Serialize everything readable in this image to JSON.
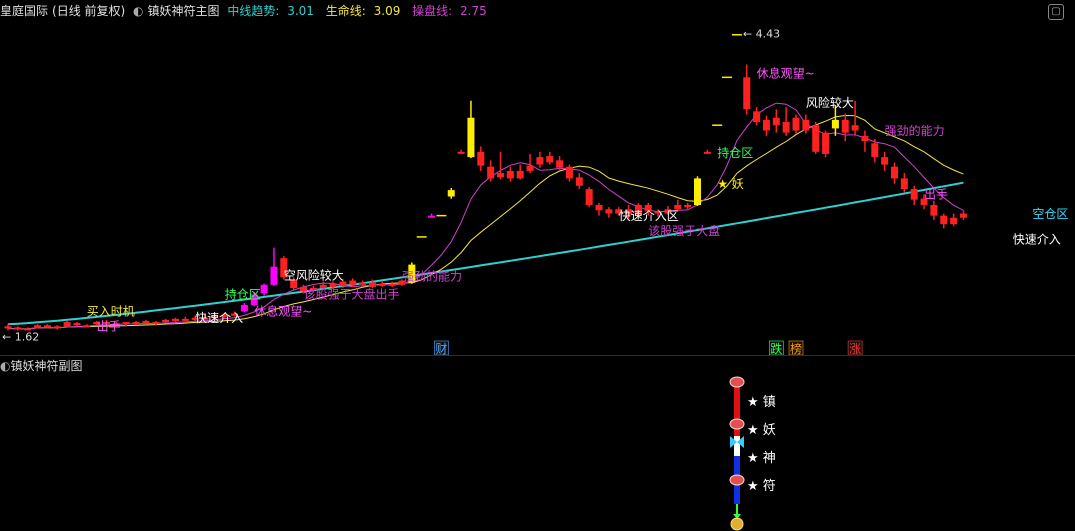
{
  "header": {
    "stock": "皇庭国际",
    "period": "(日线 前复权)",
    "toggle_icon": "collapse-icon",
    "indicator_name": "镇妖神符主图",
    "metrics": [
      {
        "label": "中线趋势: ",
        "value": "3.01",
        "color": "#2fd0d0"
      },
      {
        "label": "生命线: ",
        "value": "3.09",
        "color": "#f5e642"
      },
      {
        "label": "操盘线: ",
        "value": "2.75",
        "color": "#d040d0"
      }
    ]
  },
  "sub_header": {
    "indicator_name": "镇妖神符副图"
  },
  "chart_data": {
    "type": "candlestick",
    "candles": [
      {
        "o": 1.66,
        "c": 1.64,
        "h": 1.68,
        "l": 1.62
      },
      {
        "o": 1.65,
        "c": 1.63,
        "h": 1.66,
        "l": 1.62
      },
      {
        "o": 1.64,
        "c": 1.64,
        "h": 1.65,
        "l": 1.63
      },
      {
        "o": 1.65,
        "c": 1.67,
        "h": 1.68,
        "l": 1.64
      },
      {
        "o": 1.67,
        "c": 1.65,
        "h": 1.68,
        "l": 1.64
      },
      {
        "o": 1.66,
        "c": 1.64,
        "h": 1.67,
        "l": 1.63
      },
      {
        "o": 1.66,
        "c": 1.7,
        "h": 1.71,
        "l": 1.65
      },
      {
        "o": 1.69,
        "c": 1.67,
        "h": 1.7,
        "l": 1.66
      },
      {
        "o": 1.67,
        "c": 1.66,
        "h": 1.68,
        "l": 1.65
      },
      {
        "o": 1.68,
        "c": 1.7,
        "h": 1.71,
        "l": 1.67
      },
      {
        "o": 1.7,
        "c": 1.68,
        "h": 1.72,
        "l": 1.67
      },
      {
        "o": 1.68,
        "c": 1.69,
        "h": 1.7,
        "l": 1.67
      },
      {
        "o": 1.7,
        "c": 1.68,
        "h": 1.7,
        "l": 1.66
      },
      {
        "o": 1.68,
        "c": 1.7,
        "h": 1.71,
        "l": 1.67
      },
      {
        "o": 1.71,
        "c": 1.69,
        "h": 1.72,
        "l": 1.68
      },
      {
        "o": 1.7,
        "c": 1.68,
        "h": 1.71,
        "l": 1.67
      },
      {
        "o": 1.7,
        "c": 1.72,
        "h": 1.73,
        "l": 1.69
      },
      {
        "o": 1.73,
        "c": 1.71,
        "h": 1.74,
        "l": 1.7
      },
      {
        "o": 1.72,
        "c": 1.73,
        "h": 1.75,
        "l": 1.71
      },
      {
        "o": 1.74,
        "c": 1.72,
        "h": 1.76,
        "l": 1.71
      },
      {
        "o": 1.73,
        "c": 1.74,
        "h": 1.77,
        "l": 1.72
      },
      {
        "o": 1.74,
        "c": 1.76,
        "h": 1.78,
        "l": 1.73
      },
      {
        "o": 1.77,
        "c": 1.75,
        "h": 1.78,
        "l": 1.74
      },
      {
        "o": 1.76,
        "c": 1.78,
        "h": 1.8,
        "l": 1.75
      },
      {
        "o": 1.8,
        "c": 1.86,
        "h": 1.88,
        "l": 1.79
      },
      {
        "o": 1.86,
        "c": 1.96,
        "h": 1.98,
        "l": 1.85
      },
      {
        "o": 1.97,
        "c": 2.05,
        "h": 2.06,
        "l": 1.95
      },
      {
        "o": 2.05,
        "c": 2.22,
        "h": 2.4,
        "l": 2.04
      },
      {
        "o": 2.3,
        "c": 2.12,
        "h": 2.32,
        "l": 2.1
      },
      {
        "o": 2.1,
        "c": 2.02,
        "h": 2.12,
        "l": 2.0
      },
      {
        "o": 2.03,
        "c": 1.99,
        "h": 2.05,
        "l": 1.97
      },
      {
        "o": 2.0,
        "c": 2.02,
        "h": 2.04,
        "l": 1.98
      },
      {
        "o": 2.02,
        "c": 2.05,
        "h": 2.08,
        "l": 2.0
      },
      {
        "o": 2.06,
        "c": 2.03,
        "h": 2.08,
        "l": 2.01
      },
      {
        "o": 2.04,
        "c": 2.08,
        "h": 2.1,
        "l": 2.02
      },
      {
        "o": 2.09,
        "c": 2.05,
        "h": 2.11,
        "l": 2.03
      },
      {
        "o": 2.05,
        "c": 2.07,
        "h": 2.09,
        "l": 2.04
      },
      {
        "o": 2.07,
        "c": 2.03,
        "h": 2.1,
        "l": 2.02
      },
      {
        "o": 2.04,
        "c": 2.06,
        "h": 2.08,
        "l": 2.03
      },
      {
        "o": 2.06,
        "c": 2.04,
        "h": 2.08,
        "l": 2.03
      },
      {
        "o": 2.05,
        "c": 2.09,
        "h": 2.1,
        "l": 2.04
      },
      {
        "o": 2.07,
        "c": 2.24,
        "h": 2.26,
        "l": 2.06
      },
      {
        "o": 2.5,
        "c": 2.5,
        "h": 2.52,
        "l": 2.48
      },
      {
        "o": 2.7,
        "c": 2.7,
        "h": 2.72,
        "l": 2.68
      },
      {
        "o": 2.98,
        "c": 2.7,
        "h": 3.0,
        "l": 2.68
      },
      {
        "o": 2.88,
        "c": 2.94,
        "h": 2.96,
        "l": 2.86
      },
      {
        "o": 3.3,
        "c": 3.3,
        "h": 3.32,
        "l": 3.28
      },
      {
        "o": 3.25,
        "c": 3.62,
        "h": 3.78,
        "l": 3.24
      },
      {
        "o": 3.3,
        "c": 3.17,
        "h": 3.35,
        "l": 3.12
      },
      {
        "o": 3.16,
        "c": 3.05,
        "h": 3.22,
        "l": 3.02
      },
      {
        "o": 3.06,
        "c": 3.1,
        "h": 3.3,
        "l": 3.04
      },
      {
        "o": 3.12,
        "c": 3.05,
        "h": 3.16,
        "l": 3.02
      },
      {
        "o": 3.05,
        "c": 3.12,
        "h": 3.18,
        "l": 3.04
      },
      {
        "o": 3.12,
        "c": 3.17,
        "h": 3.28,
        "l": 3.1
      },
      {
        "o": 3.18,
        "c": 3.25,
        "h": 3.3,
        "l": 3.15
      },
      {
        "o": 3.26,
        "c": 3.2,
        "h": 3.3,
        "l": 3.18
      },
      {
        "o": 3.22,
        "c": 3.15,
        "h": 3.26,
        "l": 3.13
      },
      {
        "o": 3.16,
        "c": 3.05,
        "h": 3.18,
        "l": 3.02
      },
      {
        "o": 3.06,
        "c": 2.98,
        "h": 3.1,
        "l": 2.95
      },
      {
        "o": 2.95,
        "c": 2.8,
        "h": 2.97,
        "l": 2.78
      },
      {
        "o": 2.8,
        "c": 2.75,
        "h": 2.82,
        "l": 2.7
      },
      {
        "o": 2.76,
        "c": 2.72,
        "h": 2.78,
        "l": 2.68
      },
      {
        "o": 2.72,
        "c": 2.76,
        "h": 2.78,
        "l": 2.7
      },
      {
        "o": 2.76,
        "c": 2.71,
        "h": 2.8,
        "l": 2.67
      },
      {
        "o": 2.71,
        "c": 2.8,
        "h": 2.82,
        "l": 2.7
      },
      {
        "o": 2.8,
        "c": 2.74,
        "h": 2.82,
        "l": 2.7
      },
      {
        "o": 2.74,
        "c": 2.72,
        "h": 2.76,
        "l": 2.69
      },
      {
        "o": 2.72,
        "c": 2.76,
        "h": 2.79,
        "l": 2.71
      },
      {
        "o": 2.76,
        "c": 2.8,
        "h": 2.85,
        "l": 2.74
      },
      {
        "o": 2.8,
        "c": 2.78,
        "h": 2.82,
        "l": 2.75
      },
      {
        "o": 2.8,
        "c": 3.05,
        "h": 3.07,
        "l": 2.79
      },
      {
        "o": 3.3,
        "c": 3.3,
        "h": 3.32,
        "l": 3.28
      },
      {
        "o": 3.55,
        "c": 3.55,
        "h": 3.57,
        "l": 3.53
      },
      {
        "o": 4.0,
        "c": 4.0,
        "h": 4.02,
        "l": 3.98
      },
      {
        "o": 4.42,
        "c": 4.4,
        "h": 4.43,
        "l": 4.38
      },
      {
        "o": 4.0,
        "c": 3.7,
        "h": 4.12,
        "l": 3.65
      },
      {
        "o": 3.68,
        "c": 3.58,
        "h": 3.72,
        "l": 3.55
      },
      {
        "o": 3.6,
        "c": 3.5,
        "h": 3.64,
        "l": 3.45
      },
      {
        "o": 3.55,
        "c": 3.62,
        "h": 3.7,
        "l": 3.48
      },
      {
        "o": 3.58,
        "c": 3.48,
        "h": 3.72,
        "l": 3.45
      },
      {
        "o": 3.5,
        "c": 3.62,
        "h": 3.65,
        "l": 3.47
      },
      {
        "o": 3.6,
        "c": 3.5,
        "h": 3.65,
        "l": 3.47
      },
      {
        "o": 3.55,
        "c": 3.3,
        "h": 3.58,
        "l": 3.28
      },
      {
        "o": 3.48,
        "c": 3.28,
        "h": 3.5,
        "l": 3.25
      },
      {
        "o": 3.52,
        "c": 3.6,
        "h": 3.74,
        "l": 3.45
      },
      {
        "o": 3.6,
        "c": 3.48,
        "h": 3.66,
        "l": 3.4
      },
      {
        "o": 3.55,
        "c": 3.5,
        "h": 3.78,
        "l": 3.45
      },
      {
        "o": 3.45,
        "c": 3.4,
        "h": 3.5,
        "l": 3.3
      },
      {
        "o": 3.38,
        "c": 3.25,
        "h": 3.42,
        "l": 3.2
      },
      {
        "o": 3.25,
        "c": 3.18,
        "h": 3.3,
        "l": 3.12
      },
      {
        "o": 3.16,
        "c": 3.05,
        "h": 3.2,
        "l": 3.0
      },
      {
        "o": 3.05,
        "c": 2.95,
        "h": 3.1,
        "l": 2.92
      },
      {
        "o": 2.95,
        "c": 2.85,
        "h": 2.98,
        "l": 2.8
      },
      {
        "o": 2.86,
        "c": 2.8,
        "h": 2.9,
        "l": 2.76
      },
      {
        "o": 2.8,
        "c": 2.7,
        "h": 2.84,
        "l": 2.66
      },
      {
        "o": 2.7,
        "c": 2.62,
        "h": 2.72,
        "l": 2.58
      },
      {
        "o": 2.62,
        "c": 2.68,
        "h": 2.72,
        "l": 2.6
      },
      {
        "o": 2.68,
        "c": 2.72,
        "h": 2.75,
        "l": 2.66
      }
    ],
    "hl_color": {
      "41": "#ffee00",
      "45": "#ffee00",
      "47": "#ffee00",
      "70": "#ffee00",
      "84": "#ffee00",
      "24": "#ff00ff",
      "25": "#ff00ff",
      "26": "#ff00ff",
      "27": "#ff00ff",
      "43": "#ff00ff"
    },
    "ticks_stub": {
      "42": "#ffee00",
      "44": "#ffee00",
      "72": "#ffee00",
      "73": "#ffee00",
      "74": "#ffee00"
    },
    "lines": {
      "trend": {
        "color": "#2fd0d0",
        "start": 1.68,
        "end": 3.01
      },
      "life": {
        "color": "#f5e642",
        "end": 3.09
      },
      "operate": {
        "color": "#d040d0",
        "end": 2.75
      }
    },
    "ylim": [
      1.55,
      4.52
    ],
    "high_label": "4.43",
    "low_label": "1.62",
    "annotations": [
      {
        "text": "买入时机",
        "i": 8,
        "p": 1.76,
        "color": "#f5e642"
      },
      {
        "text": "出手",
        "i": 9,
        "p": 1.62,
        "color": "#ff55ff"
      },
      {
        "text": "快速介入",
        "i": 19,
        "p": 1.7,
        "color": "#ffffff"
      },
      {
        "text": "休息观望~",
        "i": 25,
        "p": 1.76,
        "color": "#ff55ff"
      },
      {
        "text": "持仓区",
        "i": 22,
        "p": 1.92,
        "color": "#33ff55"
      },
      {
        "text": "空风险较大",
        "i": 28,
        "p": 2.1,
        "color": "#ffffff"
      },
      {
        "text": "该股强于大盘出手",
        "i": 30,
        "p": 1.92,
        "color": "#d040d0"
      },
      {
        "text": "强劲的能力",
        "i": 40,
        "p": 2.09,
        "color": "#d040d0"
      },
      {
        "text": "快速介入区",
        "i": 62,
        "p": 2.66,
        "color": "#ffffff"
      },
      {
        "text": "该股强于大盘",
        "i": 65,
        "p": 2.52,
        "color": "#d040d0"
      },
      {
        "text": "持仓区",
        "i": 72,
        "p": 3.25,
        "color": "#33ff55"
      },
      {
        "text": "★ 妖",
        "i": 72,
        "p": 2.96,
        "color": "#ffee00"
      },
      {
        "text": "休息观望~",
        "i": 76,
        "p": 4.0,
        "color": "#ff55ff"
      },
      {
        "text": "风险较大",
        "i": 81,
        "p": 3.72,
        "color": "#ffffff"
      },
      {
        "text": "强劲的能力",
        "i": 89,
        "p": 3.46,
        "color": "#d040d0"
      },
      {
        "text": "出手",
        "i": 93,
        "p": 2.86,
        "color": "#ff55ff"
      },
      {
        "text": "空仓区",
        "i": 104,
        "p": 2.68,
        "color": "#33ddff"
      },
      {
        "text": "快速介入",
        "i": 102,
        "p": 2.44,
        "color": "#ffffff"
      }
    ],
    "markers": [
      {
        "text": "财",
        "i": 44,
        "color": "#55aaff"
      },
      {
        "text": "跌",
        "i": 78,
        "color": "#33ff55"
      },
      {
        "text": "榜",
        "i": 80,
        "color": "#ff9900"
      },
      {
        "text": "涨",
        "i": 86,
        "color": "#ff3333"
      }
    ]
  },
  "sub_chart": {
    "labels": [
      {
        "text": "★ 镇",
        "color": "#ffffff"
      },
      {
        "text": "★ 妖",
        "color": "#ffffff"
      },
      {
        "text": "★ 神",
        "color": "#ffffff"
      },
      {
        "text": "★ 符",
        "color": "#ffffff"
      }
    ],
    "segments": [
      {
        "color": "#e01010"
      },
      {
        "color": "#e01010"
      },
      {
        "color": "#ffffff"
      },
      {
        "color": "#1030e0"
      },
      {
        "color": "#1030e0"
      }
    ]
  }
}
